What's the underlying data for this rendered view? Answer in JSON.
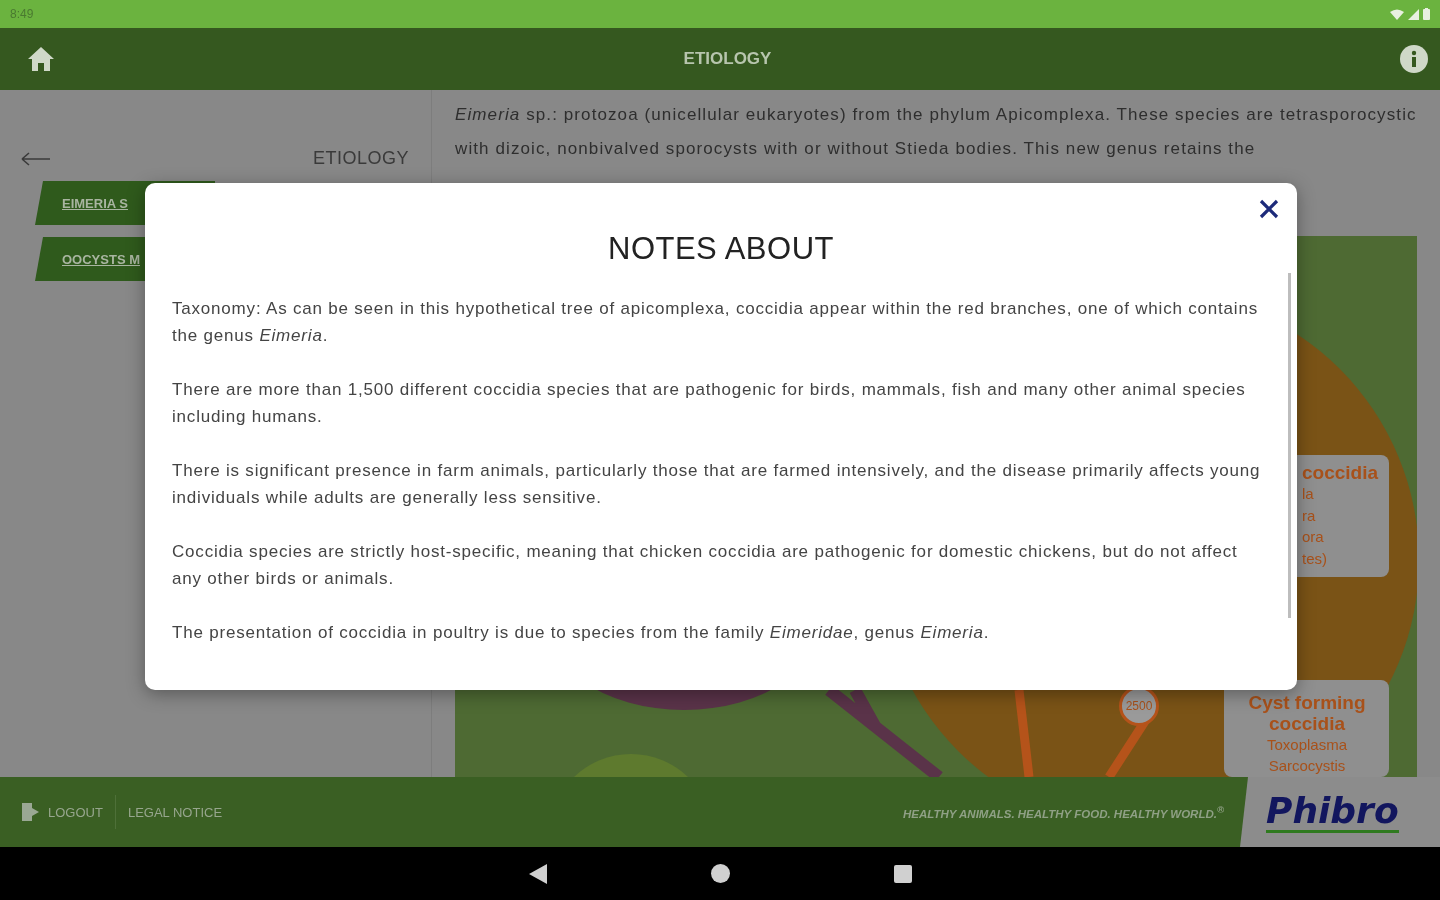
{
  "status_bar": {
    "time": "8:49"
  },
  "app_bar": {
    "title": "ETIOLOGY"
  },
  "sidebar": {
    "heading": "ETIOLOGY",
    "items": [
      {
        "label": "EIMERIA S"
      },
      {
        "label": "OOCYSTS M"
      }
    ]
  },
  "content": {
    "text": "*Eimeria* sp.: protozoa (unicellular eukaryotes) from the phylum Apicomplexa. These species are tetrasporocystic with dizoic, nonbivalved sporocysts with or without Stieda bodies. This new genus retains the",
    "diagram": {
      "badge": "2500",
      "groups": [
        {
          "title": "coccidia",
          "items": [
            "la",
            "ra",
            "ora",
            "tes)"
          ]
        },
        {
          "title": "Cyst forming coccidia",
          "items": [
            "Toxoplasma",
            "Sarcocystis"
          ]
        }
      ]
    }
  },
  "modal": {
    "title": "NOTES ABOUT",
    "paragraphs": [
      "Taxonomy: As can be seen in this hypothetical tree of apicomplexa, coccidia appear within the red branches, one of which contains the genus *Eimeria*.",
      "There are more than 1,500 different coccidia species that are pathogenic for birds, mammals, fish and many other animal species including humans.",
      "There is significant presence in farm animals, particularly those that are farmed intensively, and the disease primarily affects young individuals while adults are generally less sensitive.",
      "Coccidia species are strictly host-specific, meaning that chicken coccidia are pathogenic for domestic chickens, but do not affect any other birds or animals.",
      "The presentation of coccidia in poultry is due to species from the family *Eimeridae*, genus *Eimeria*."
    ]
  },
  "footer": {
    "links": [
      "LOGOUT",
      "LEGAL NOTICE"
    ],
    "slogan": "HEALTHY ANIMALS. HEALTHY FOOD. HEALTHY WORLD.$^{®}$",
    "logo": "Phibro"
  }
}
